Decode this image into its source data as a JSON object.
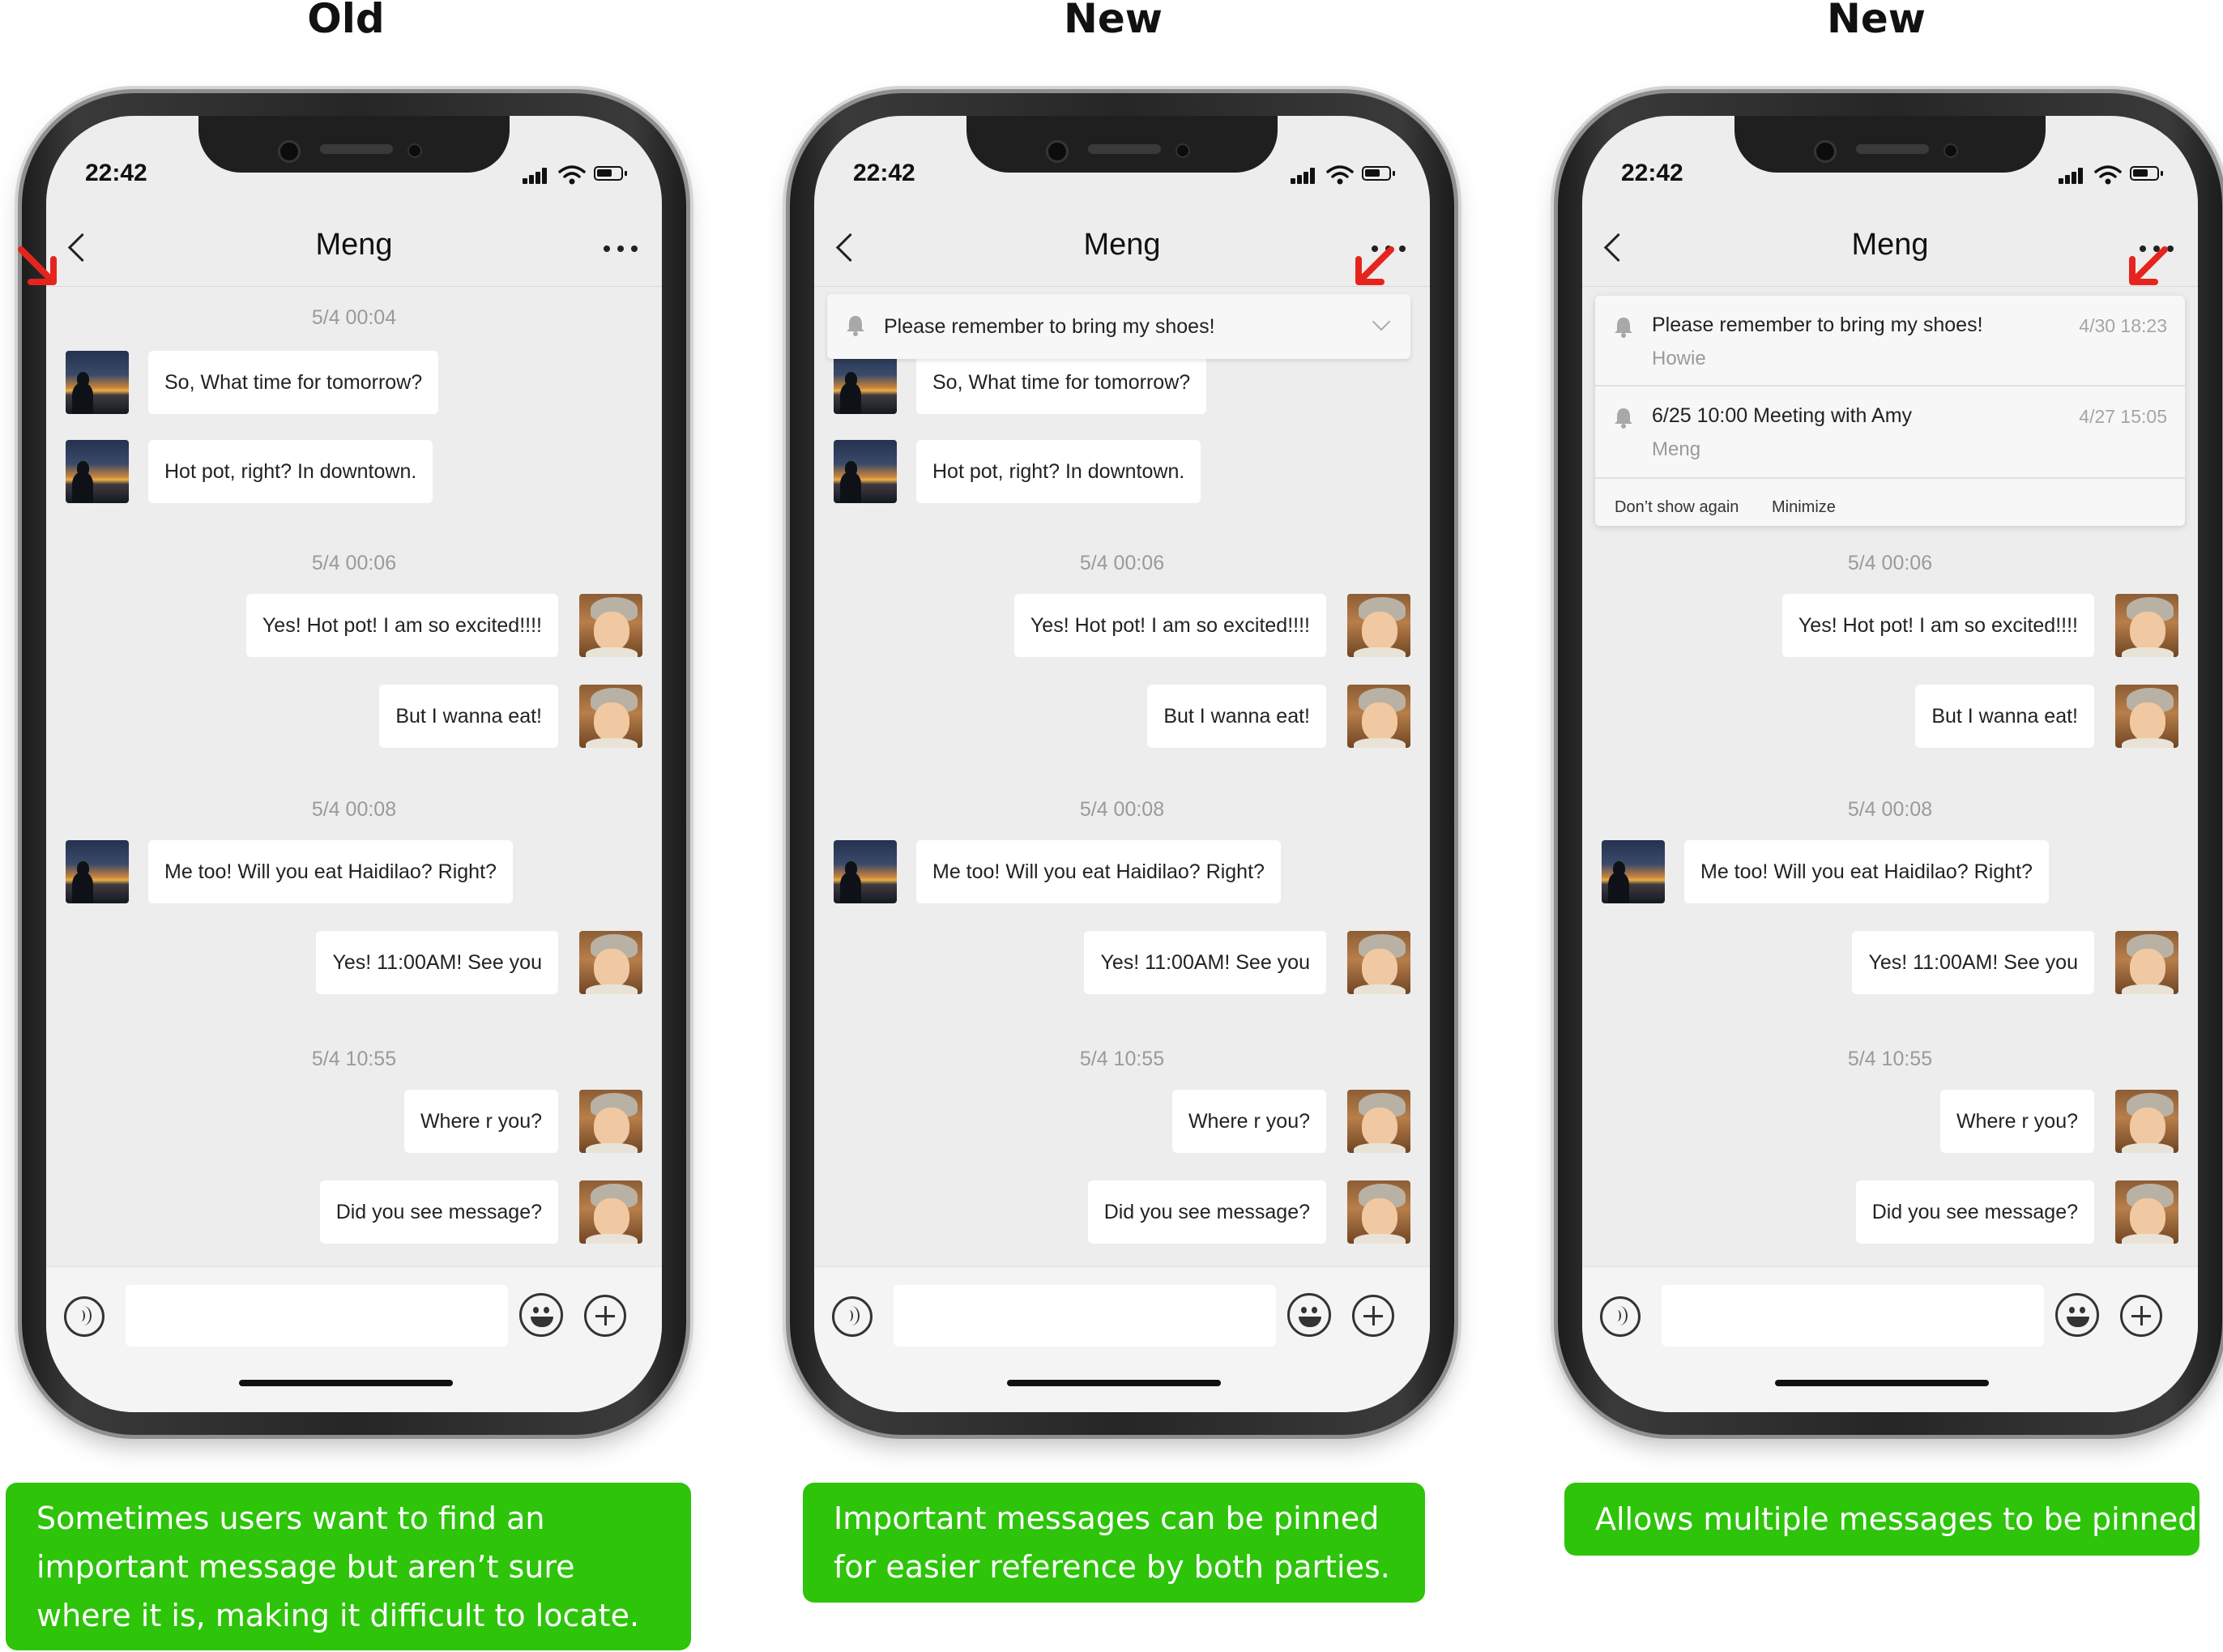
{
  "columns": [
    {
      "heading": "Old",
      "caption": "Sometimes users want to find an important message but aren’t sure where it is, making it difficult to locate.",
      "pin_mode": "none"
    },
    {
      "heading": "New",
      "caption": "Important messages can be pinned for easier reference by both parties.",
      "pin_mode": "single",
      "pinned": {
        "text": "Please remember to bring my shoes!"
      }
    },
    {
      "heading": "New",
      "caption": "Allows multiple messages to be pinned.",
      "pin_mode": "multiple",
      "pinned_list": [
        {
          "text": "Please remember to bring my shoes!",
          "sender": "Howie",
          "date": "4/30 18:23"
        },
        {
          "text": "6/25 10:00 Meeting with Amy",
          "sender": "Meng",
          "date": "4/27 15:05"
        }
      ],
      "pin_actions": {
        "dont_show": "Don’t show again",
        "minimize": "Minimize"
      }
    }
  ],
  "status_bar": {
    "time": "22:42"
  },
  "chat": {
    "title": "Meng",
    "timestamps": [
      "5/4 00:04",
      "5/4 00:06",
      "5/4 00:08",
      "5/4 10:55"
    ],
    "messages": [
      {
        "side": "left",
        "text": "So, What time for tomorrow?"
      },
      {
        "side": "left",
        "text": "Hot pot, right? In downtown."
      },
      {
        "side": "right",
        "text": "Yes! Hot pot! I am so excited!!!!"
      },
      {
        "side": "right",
        "text": "But I wanna eat!"
      },
      {
        "side": "left",
        "text": "Me too! Will you eat Haidilao? Right?"
      },
      {
        "side": "right",
        "text": "Yes! 11:00AM! See you"
      },
      {
        "side": "right",
        "text": "Where r you?"
      },
      {
        "side": "right",
        "text": "Did you see message?"
      }
    ]
  },
  "icons": {
    "back": "chevron-left-icon",
    "more": "more-dots-icon",
    "voice": "voice-icon",
    "emoji": "emoji-icon",
    "plus": "plus-icon",
    "pin": "bell-icon",
    "pointer": "red-arrow-icon"
  },
  "colors": {
    "caption_bg": "#2dc40a",
    "chat_bg": "#ededed",
    "arrow": "#e5251d"
  }
}
